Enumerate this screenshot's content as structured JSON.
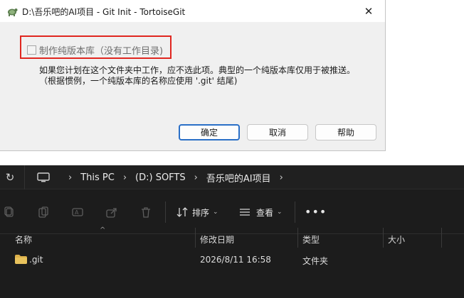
{
  "dialog": {
    "title": "D:\\吾乐吧的AI项目 - Git Init - TortoiseGit",
    "bare_checkbox_label": "制作纯版本库（没有工作目录)",
    "bare_checked": false,
    "hint": "如果您计划在这个文件夹中工作，应不选此项。典型的一个纯版本库仅用于被推送。（根据惯例，一个纯版本库的名称应使用 '.git' 结尾)",
    "buttons": {
      "ok": "确定",
      "cancel": "取消",
      "help": "帮助"
    }
  },
  "explorer": {
    "breadcrumb": [
      "This PC",
      "(D:) SOFTS",
      "吾乐吧的AI项目"
    ],
    "toolbar": {
      "sort_label": "排序",
      "view_label": "查看"
    },
    "columns": {
      "name": "名称",
      "modified": "修改日期",
      "type": "类型",
      "size": "大小"
    },
    "files": [
      {
        "name": ".git",
        "modified": "2026/8/11 16:58",
        "type": "文件夹",
        "size": ""
      }
    ]
  },
  "colors": {
    "highlight_red": "#e0261f",
    "primary_blue": "#2a6fc7",
    "folder_yellow": "#dcb04a"
  }
}
